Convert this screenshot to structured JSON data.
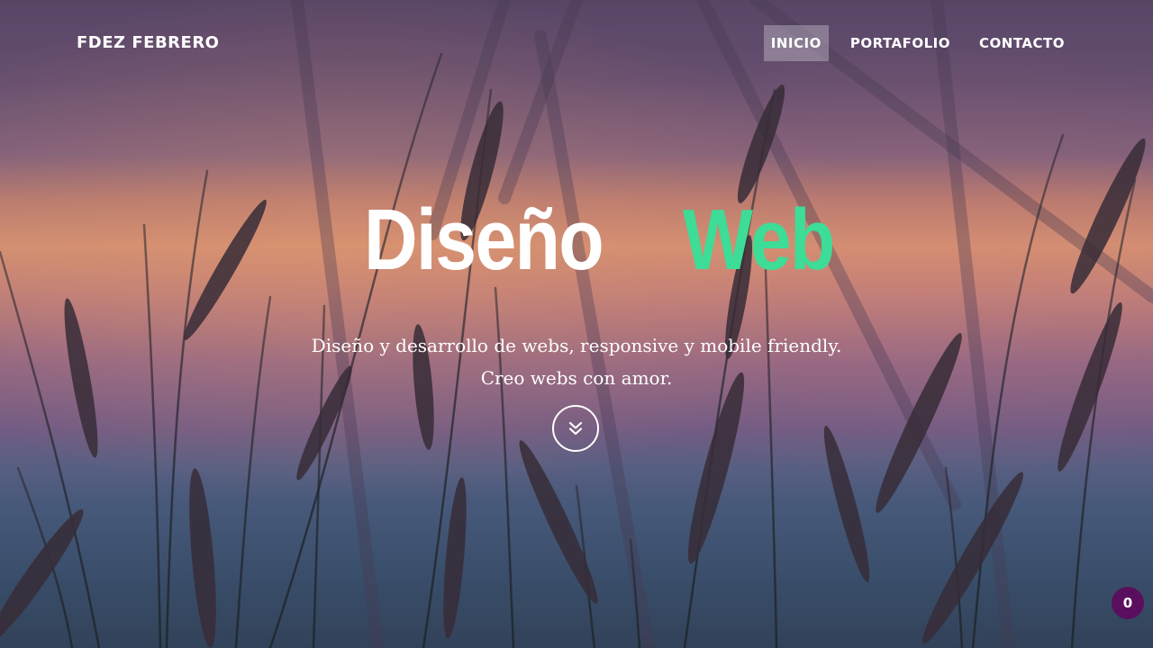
{
  "brand": {
    "name": "FDEZ FEBRERO"
  },
  "nav": {
    "items": [
      {
        "label": "INICIO",
        "active": true
      },
      {
        "label": "PORTAFOLIO",
        "active": false
      },
      {
        "label": "CONTACTO",
        "active": false
      }
    ]
  },
  "hero": {
    "title_first": "Diseño",
    "title_second": "Web",
    "subtitle_line1": "Diseño y desarrollo de webs, responsive y mobile friendly.",
    "subtitle_line2": "Creo webs con amor.",
    "scroll_icon": "double-chevron-down-icon",
    "background": "grass-sunset-photo"
  },
  "colors": {
    "accent": "#3ddc97",
    "badge_bg": "#5a0f5e",
    "text": "#ffffff"
  },
  "badge": {
    "count": "0"
  }
}
